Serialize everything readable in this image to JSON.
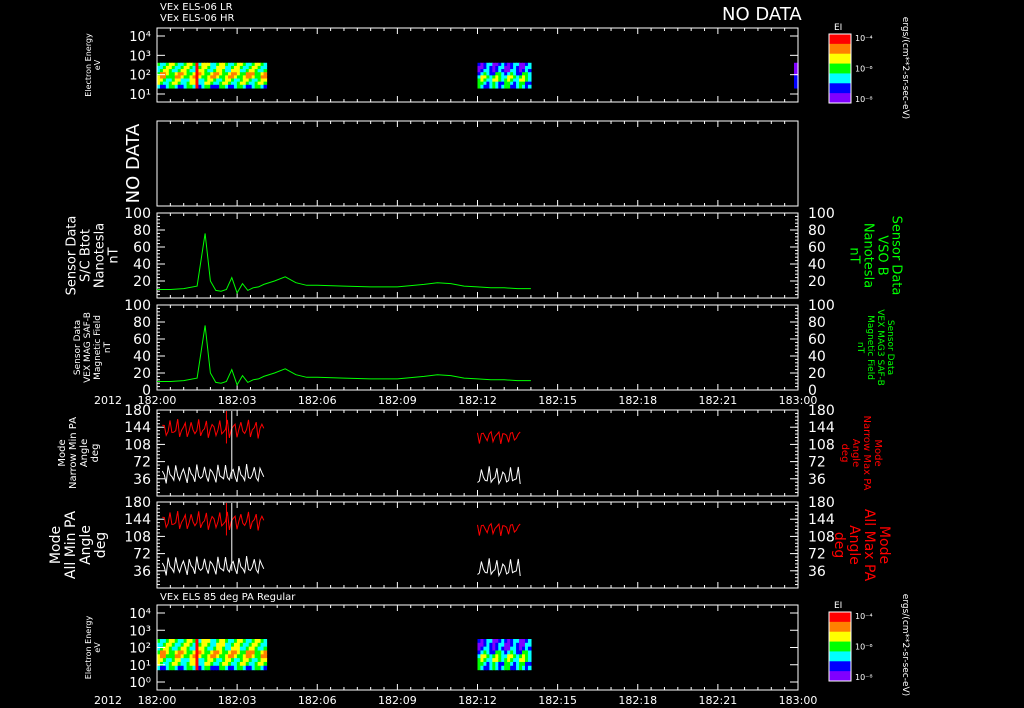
{
  "header": {
    "instrument_lr": "VEx ELS-06 LR",
    "instrument_hr": "VEx ELS-06 HR",
    "no_data": "NO DATA",
    "bottom_title": "VEx ELS 85 deg PA Regular"
  },
  "colorbar": {
    "label": "EI",
    "units": "ergs/(cm**2-sr-sec-eV)",
    "ticks": [
      "10⁻⁴",
      "10⁻⁶",
      "10⁻⁸"
    ],
    "colors": [
      "#ff0000",
      "#ff8000",
      "#ffff00",
      "#00ff00",
      "#00ffff",
      "#0000ff",
      "#8000ff"
    ]
  },
  "time_axis": {
    "year": "2012",
    "ticks": [
      "182:00",
      "182:03",
      "182:06",
      "182:09",
      "182:12",
      "182:15",
      "182:18",
      "182:21",
      "183:00"
    ]
  },
  "chart_data": [
    {
      "type": "heatmap",
      "id": "els-lr-hr",
      "ylabel": [
        "Electron Energy",
        "eV"
      ],
      "yticks": [
        "10⁴",
        "10³",
        "10²",
        "10¹"
      ],
      "segments": [
        {
          "x0": 0.0,
          "x1": 4.1,
          "kind": "hot"
        },
        {
          "x0": 12.0,
          "x1": 14.0,
          "kind": "cool"
        },
        {
          "x0": 23.85,
          "x1": 24.0,
          "kind": "edge"
        }
      ]
    },
    {
      "type": "line",
      "id": "nodata-panel",
      "label": "NO DATA"
    },
    {
      "type": "line",
      "id": "sc-btot",
      "ylabel": [
        "Sensor Data",
        "S/C Btot",
        "Nanotesla",
        "nT"
      ],
      "rlabel": [
        "Sensor Data",
        "VSO B",
        "Nanotesla",
        "nT"
      ],
      "ylim": [
        0,
        100
      ],
      "yticks": [
        "100",
        "80",
        "60",
        "40",
        "20"
      ],
      "series": [
        {
          "values_from": "b_field",
          "color": "#00ff00"
        }
      ]
    },
    {
      "type": "line",
      "id": "mag-saf-b",
      "ylabel": [
        "Sensor Data",
        "VEX MAG SAF-B",
        "Magnetic Field",
        "nT"
      ],
      "rlabel": [
        "Sensor Data",
        "VEX MAG3 SAF-B",
        "Magnetic Field",
        "nT"
      ],
      "ylim": [
        0,
        100
      ],
      "yticks": [
        "100",
        "80",
        "60",
        "40",
        "20",
        "0"
      ],
      "series": [
        {
          "values_from": "b_field",
          "color": "#00ff00"
        }
      ]
    },
    {
      "type": "line",
      "id": "narrow-pa",
      "ylabel": [
        "Mode",
        "Narrow Min PA",
        "Angle",
        "deg"
      ],
      "rlabel": [
        "Mode",
        "Narrow Max PA",
        "Angle",
        "deg"
      ],
      "ylim": [
        0,
        180
      ],
      "yticks": [
        "180",
        "144",
        "108",
        "72",
        "36"
      ],
      "series": [
        {
          "color": "#ff0000",
          "level": "max"
        },
        {
          "color": "#ffffff",
          "level": "min"
        }
      ]
    },
    {
      "type": "line",
      "id": "all-pa",
      "ylabel": [
        "Mode",
        "All Min PA",
        "Angle",
        "deg"
      ],
      "rlabel": [
        "Mode",
        "All Max PA",
        "Angle",
        "deg"
      ],
      "ylim": [
        0,
        180
      ],
      "yticks": [
        "180",
        "144",
        "108",
        "72",
        "36"
      ],
      "series": [
        {
          "color": "#ff0000",
          "level": "max"
        },
        {
          "color": "#ffffff",
          "level": "min"
        }
      ]
    },
    {
      "type": "heatmap",
      "id": "els-85deg",
      "ylabel": [
        "Electron Energy",
        "eV"
      ],
      "yticks": [
        "10⁴",
        "10³",
        "10²",
        "10¹",
        "10⁰"
      ],
      "segments": [
        {
          "x0": 0.0,
          "x1": 4.1,
          "kind": "hot"
        },
        {
          "x0": 12.0,
          "x1": 14.0,
          "kind": "cool"
        }
      ]
    }
  ],
  "b_field": {
    "x_minutes": [
      0,
      0.5,
      1,
      1.5,
      1.8,
      2.0,
      2.2,
      2.4,
      2.6,
      2.8,
      3.0,
      3.2,
      3.4,
      3.6,
      3.8,
      4.0,
      4.4,
      4.8,
      5.2,
      5.6,
      6,
      7,
      8,
      9,
      10,
      10.5,
      11,
      11.5,
      12,
      12.5,
      13,
      13.5,
      14
    ],
    "values": [
      10,
      10,
      11,
      14,
      76,
      20,
      9,
      8,
      10,
      24,
      6,
      17,
      9,
      12,
      13,
      16,
      20,
      25,
      18,
      15,
      15,
      14,
      13,
      13,
      16,
      18,
      17,
      14,
      13,
      12,
      12,
      11,
      11
    ]
  }
}
